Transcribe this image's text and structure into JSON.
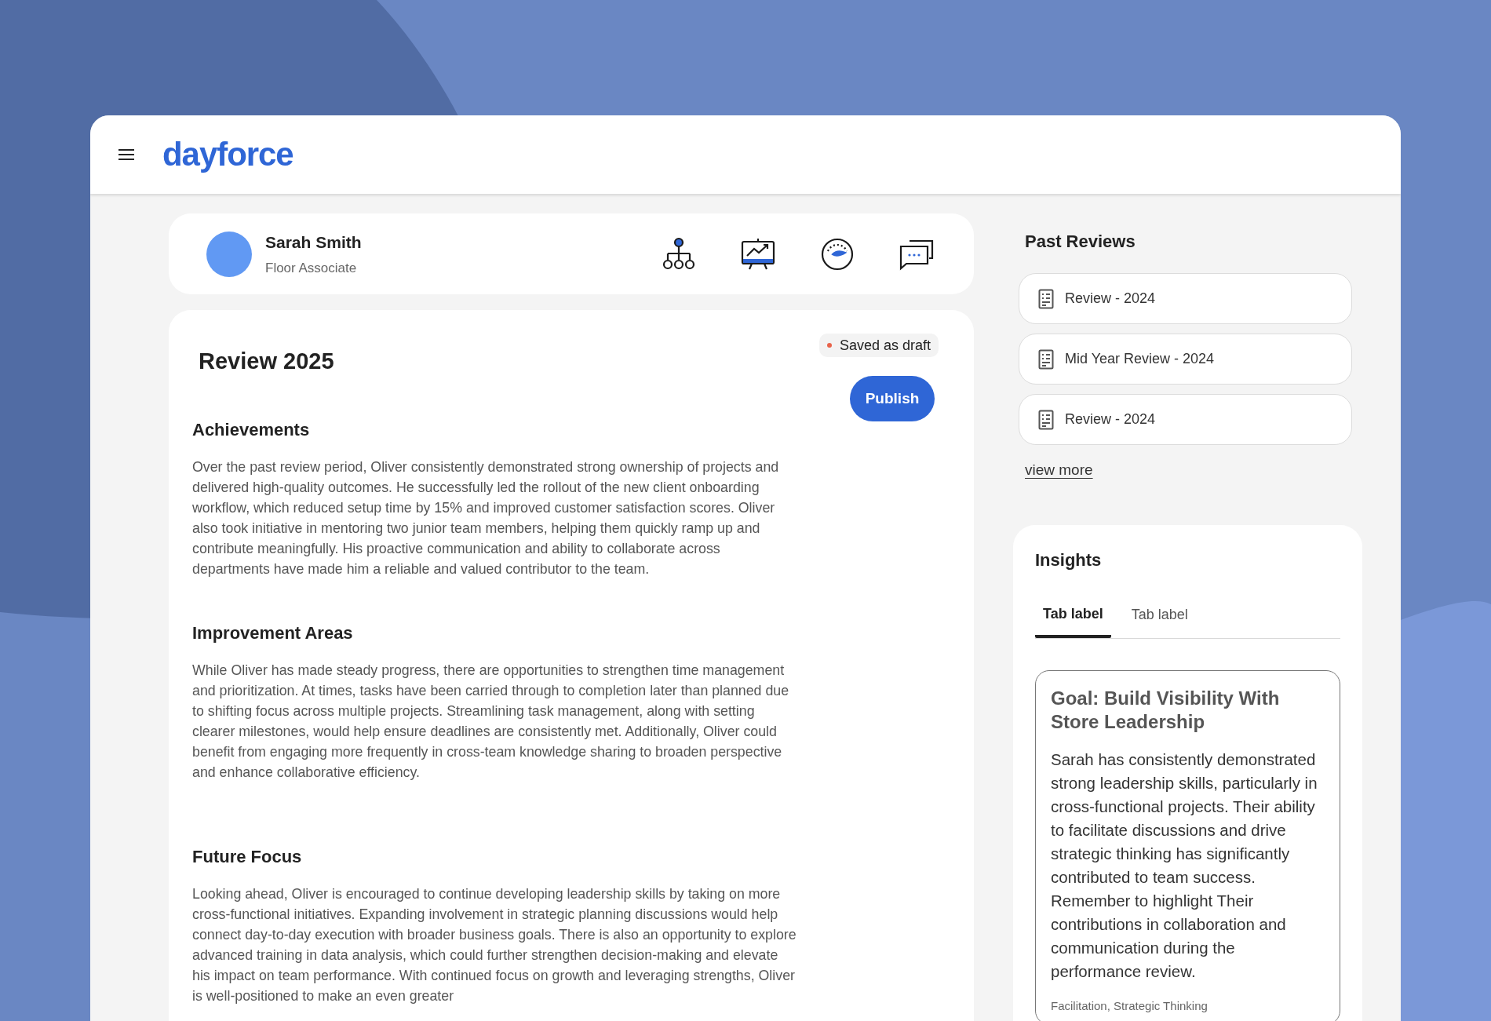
{
  "header": {
    "logo": "dayforce"
  },
  "profile": {
    "name": "Sarah Smith",
    "role": "Floor Associate"
  },
  "review": {
    "title": "Review 2025",
    "status": "Saved as draft",
    "publish_button": "Publish",
    "sections": [
      {
        "heading": "Achievements",
        "text": "Over the past review period, Oliver consistently demonstrated strong ownership of projects and delivered high-quality outcomes. He successfully led the rollout of the new client onboarding workflow, which reduced setup time by 15% and improved customer satisfaction scores. Oliver also took initiative in mentoring two junior team members, helping them quickly ramp up and contribute meaningfully. His proactive communication and ability to collaborate across departments have made him a reliable and valued contributor to the team."
      },
      {
        "heading": "Improvement Areas",
        "text": "While Oliver has made steady progress, there are opportunities to strengthen time management and prioritization. At times, tasks have been carried through to completion later than planned due to shifting focus across multiple projects. Streamlining task management, along with setting clearer milestones, would help ensure deadlines are consistently met. Additionally, Oliver could benefit from engaging more frequently in cross-team knowledge sharing to broaden perspective and enhance collaborative efficiency."
      },
      {
        "heading": "Future Focus",
        "text": "Looking ahead, Oliver is encouraged to continue developing leadership skills by taking on more cross-functional initiatives. Expanding involvement in strategic planning discussions would help connect day-to-day execution with broader business goals. There is also an opportunity to explore advanced training in data analysis, which could further strengthen decision-making and elevate his impact on team performance. With continued focus on growth and leveraging strengths, Oliver is well-positioned to make an even greater"
      }
    ]
  },
  "past_reviews": {
    "title": "Past Reviews",
    "items": [
      "Review - 2024",
      "Mid Year Review - 2024",
      "Review - 2024"
    ],
    "view_more": "view more"
  },
  "insights": {
    "title": "Insights",
    "tabs": [
      {
        "label": "Tab label",
        "selected": true
      },
      {
        "label": "Tab label",
        "selected": false
      }
    ],
    "card": {
      "title": "Goal: Build Visibility With Store Leadership",
      "text": "Sarah has consistently demonstrated strong leadership skills, particularly in cross-functional projects. Their ability to facilitate discussions and drive strategic thinking has significantly contributed to team success. Remember to highlight Their contributions in collaboration and communication during the performance review.",
      "tags": "Facilitation, Strategic Thinking"
    }
  }
}
